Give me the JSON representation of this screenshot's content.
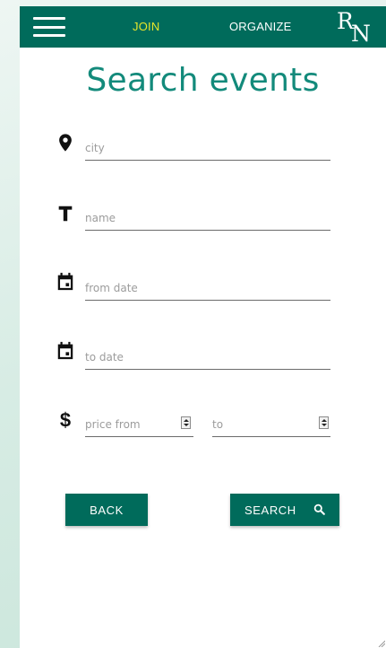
{
  "nav": {
    "join_label": "JOIN",
    "organize_label": "ORGANIZE",
    "logo_top": "R",
    "logo_bottom": "N",
    "menu_icon": "hamburger-menu-icon"
  },
  "page": {
    "title": "Search events"
  },
  "form": {
    "city": {
      "placeholder": "city",
      "value": "",
      "icon": "location-pin-icon"
    },
    "name": {
      "placeholder": "name",
      "value": "",
      "icon": "text-t-icon"
    },
    "from_date": {
      "placeholder": "from date",
      "value": "",
      "icon": "calendar-icon"
    },
    "to_date": {
      "placeholder": "to date",
      "value": "",
      "icon": "calendar-icon"
    },
    "price_from": {
      "placeholder": "price from",
      "value": "",
      "icon": "dollar-icon"
    },
    "price_to": {
      "placeholder": "to",
      "value": ""
    }
  },
  "buttons": {
    "back_label": "BACK",
    "search_label": "SEARCH",
    "search_icon": "search-icon"
  },
  "colors": {
    "primary": "#006b5b",
    "title": "#138a7b",
    "active_nav": "#e7e62a"
  }
}
